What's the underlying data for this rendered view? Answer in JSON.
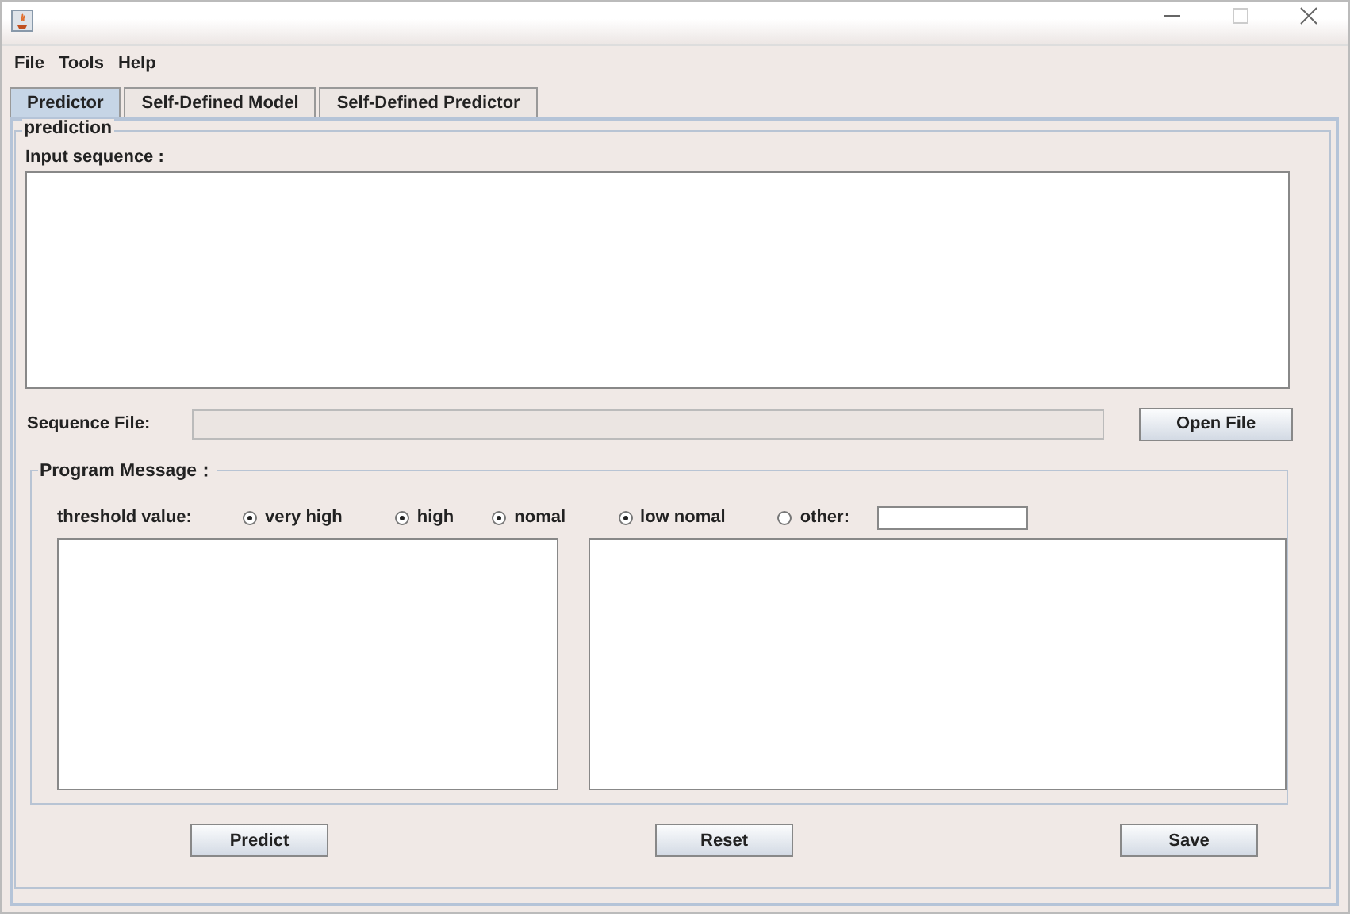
{
  "menu": [
    "File",
    "Tools",
    "Help"
  ],
  "tabs": [
    {
      "label": "Predictor",
      "selected": true
    },
    {
      "label": "Self-Defined Model",
      "selected": false
    },
    {
      "label": "Self-Defined  Predictor",
      "selected": false
    }
  ],
  "prediction": {
    "title": "prediction",
    "input_label": "Input sequence :",
    "file_label": "Sequence  File:",
    "open_button": "Open File"
  },
  "program_message": {
    "title": "Program Message：",
    "threshold_label": "threshold value:",
    "options": [
      {
        "label": "very high",
        "selected": true
      },
      {
        "label": "high",
        "selected": true
      },
      {
        "label": "nomal",
        "selected": true
      },
      {
        "label": "low nomal",
        "selected": true
      },
      {
        "label": "other:",
        "selected": false
      }
    ]
  },
  "buttons": [
    "Predict",
    "Reset",
    "Save"
  ]
}
